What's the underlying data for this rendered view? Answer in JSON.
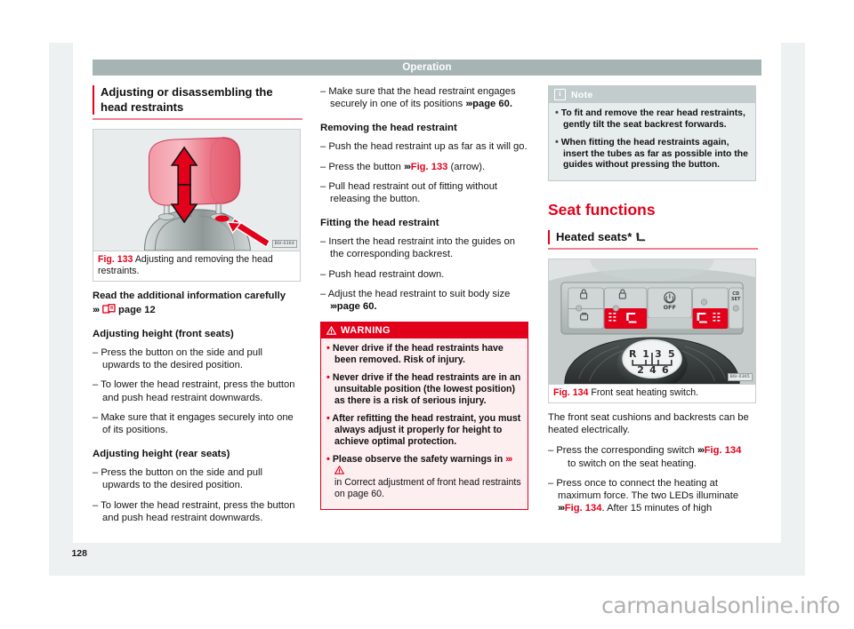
{
  "header": {
    "title": "Operation"
  },
  "folio": "128",
  "watermark": "carmanualsonline.info",
  "col1": {
    "heading": "Adjusting or disassembling the head restraints",
    "figure": {
      "number": "Fig. 133",
      "caption": "Adjusting and removing the head restraints.",
      "code": "B6I-0364"
    },
    "read_info": {
      "line1": "Read the additional information carefully",
      "chevron": "›››",
      "page_ref": "page 12"
    },
    "sub1": "Adjusting height (front seats)",
    "items1": [
      "Press the button on the side and pull upwards to the desired position.",
      "To lower the head restraint, press the button and push head restraint downwards.",
      "Make sure that it engages securely into one of its positions."
    ],
    "sub2": "Adjusting height (rear seats)",
    "items2": [
      "Press the button on the side and pull upwards to the desired position.",
      "To lower the head restraint, press the button and push head restraint downwards."
    ]
  },
  "col2": {
    "item_top_a": "Make sure that the head restraint engages securely in one of its positions",
    "item_top_ref": "page 60.",
    "sub1": "Removing the head restraint",
    "items1_a": "Push the head restraint up as far as it will go.",
    "items1_b_pre": "Press the button",
    "items1_b_ref": "Fig. 133",
    "items1_b_post": "(arrow).",
    "items1_c": "Pull head restraint out of fitting without releasing the button.",
    "sub2": "Fitting the head restraint",
    "items2_a": "Insert the head restraint into the guides on the corresponding backrest.",
    "items2_b": "Push head restraint down.",
    "items2_c_pre": "Adjust the head restraint to suit body size",
    "items2_c_ref": "page 60.",
    "warning": {
      "title": "WARNING",
      "items": [
        "Never drive if the head restraints have been removed. Risk of injury.",
        "Never drive if the head restraints are in an unsuitable position (the lowest position) as there is a risk of serious injury.",
        "After refitting the head restraint, you must always adjust it properly for height to achieve optimal protection."
      ],
      "last_bold": "Please observe the safety warnings in",
      "last_regular": "in Correct adjustment of front head restraints on page 60."
    }
  },
  "col3": {
    "note": {
      "title": "Note",
      "items": [
        "To fit and remove the rear head restraints, gently tilt the seat backrest forwards.",
        "When fitting the head restraints again, insert the tubes as far as possible into the guides without pressing the button."
      ]
    },
    "section_title": "Seat functions",
    "heading": "Heated seats*",
    "figure": {
      "number": "Fig. 134",
      "caption": "Front seat heating switch.",
      "code": "B6I-0365"
    },
    "intro": "The front seat cushions and backrests can be heated electrically.",
    "item1_pre": "Press the corresponding switch",
    "item1_ref": "Fig. 134",
    "item1_post": "to switch on the seat heating.",
    "item2_pre": "Press once to connect the heating at maximum force. The two LEDs illuminate",
    "item2_ref": "Fig. 134",
    "item2_post": ". After 15 minutes of high"
  },
  "fig134_labels": {
    "auto_off": "OFF",
    "cd_set_1": "CD",
    "cd_set_2": "SET",
    "gear_r": "R",
    "gear_1": "1",
    "gear_3": "3",
    "gear_5": "5",
    "gear_2": "2",
    "gear_4": "4",
    "gear_6": "6"
  },
  "colors": {
    "accent_red": "#e2001a",
    "header_grey": "#a6b4b4",
    "note_grey": "#c3cccd",
    "mat_grey": "#eef1f1"
  }
}
